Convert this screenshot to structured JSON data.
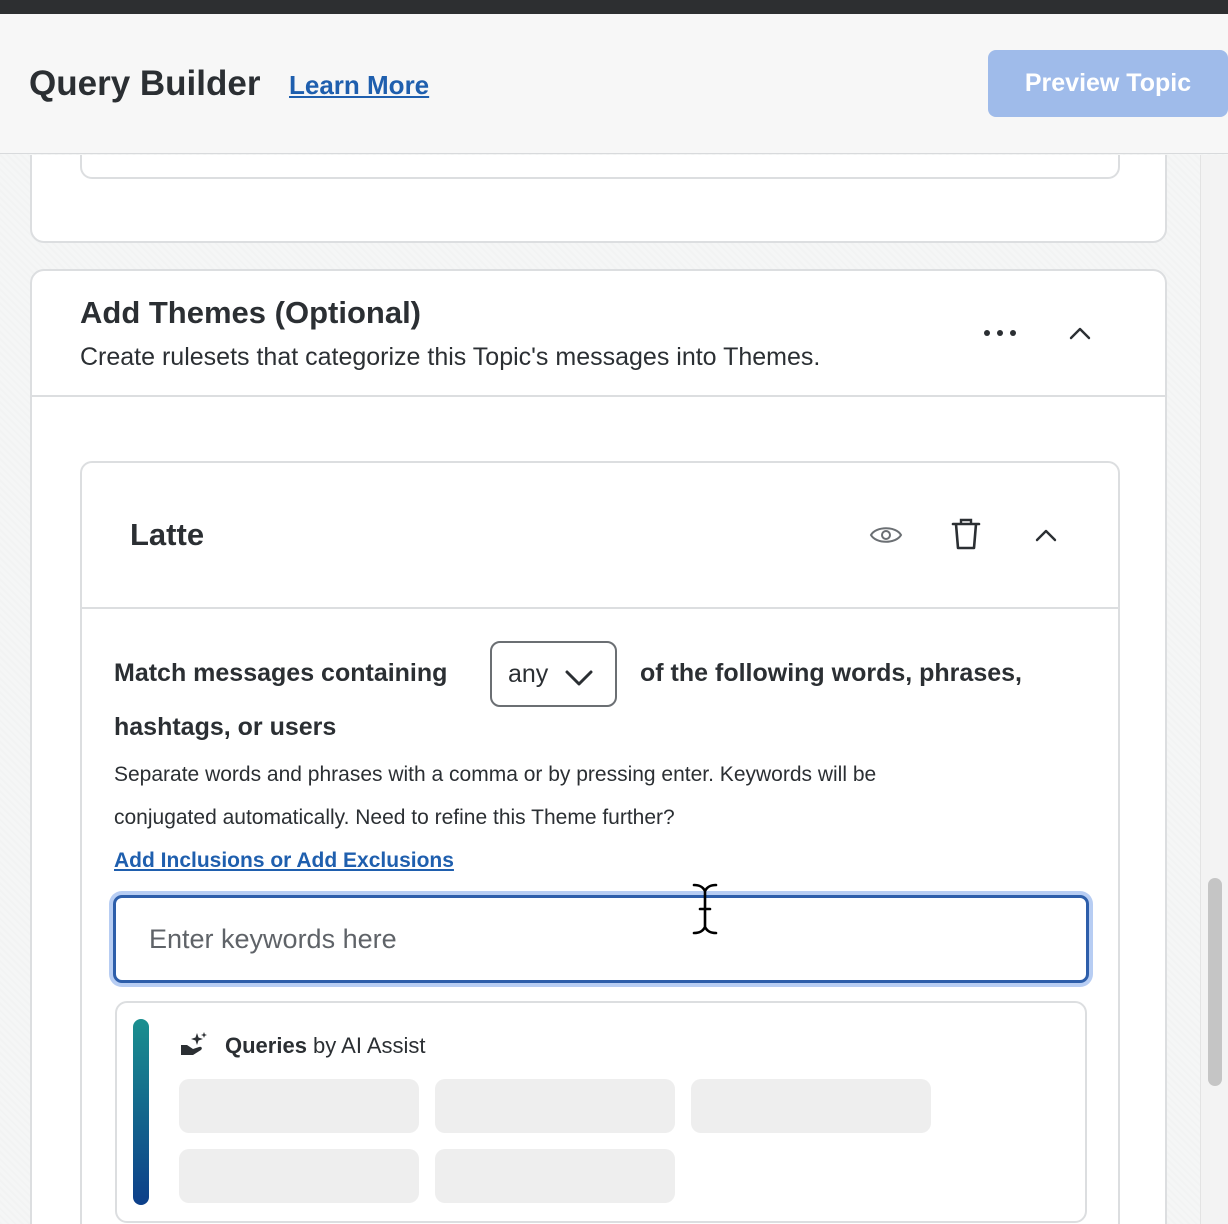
{
  "header": {
    "title": "Query Builder",
    "learn_more": "Learn More",
    "preview_button": "Preview Topic"
  },
  "themes_section": {
    "title": "Add Themes (Optional)",
    "subtitle": "Create rulesets that categorize this Topic's messages into Themes.",
    "more_icon": "more-horizontal-icon",
    "collapse_icon": "chevron-up-icon"
  },
  "theme": {
    "name": "Latte",
    "icons": [
      "eye-icon",
      "trash-icon",
      "chevron-up-icon"
    ],
    "match_prefix": "Match messages containing",
    "match_select": "any",
    "match_suffix": "of the following words, phrases,",
    "match_suffix_2": "hashtags, or users",
    "help_line_1": "Separate words and phrases with a comma or by pressing enter. Keywords will be",
    "help_line_2": "conjugated automatically. Need to refine this Theme further?",
    "add_link": "Add Inclusions or Add Exclusions",
    "input_placeholder": "Enter keywords here",
    "input_value": ""
  },
  "ai_assist": {
    "title_bold": "Queries",
    "title_rest": " by AI Assist",
    "icon": "ai-sparkle-hand-icon",
    "skeleton_count": 5
  },
  "colors": {
    "link": "#1f5fae",
    "preview_button_bg": "#9fbbea",
    "input_focus_border": "#2d5eaa",
    "ai_gradient_top": "#1a8f8f",
    "ai_gradient_bottom": "#0d3f8a"
  }
}
